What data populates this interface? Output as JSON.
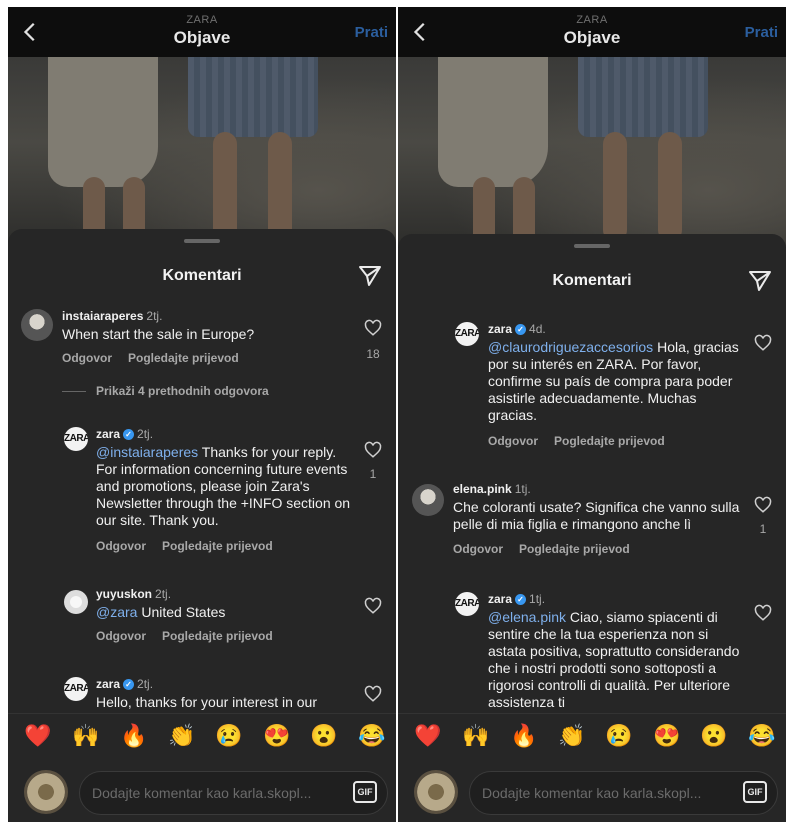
{
  "header": {
    "brand": "ZARA",
    "title": "Objave",
    "follow_label": "Prati"
  },
  "sheet": {
    "title": "Komentari"
  },
  "left": {
    "c1": {
      "user": "instaiaraperes",
      "time": "2tj.",
      "text": "When start the sale in Europe?",
      "reply": "Odgovor",
      "translate": "Pogledajte prijevod",
      "likes": "18"
    },
    "more_replies": "Prikaži 4 prethodnih odgovora",
    "c2": {
      "user": "zara",
      "time": "2tj.",
      "mention": "@instaiaraperes",
      "text": " Thanks for your reply. For information concerning future events and promotions, please join Zara's Newsletter through the +INFO section on our site. Thank you.",
      "reply": "Odgovor",
      "translate": "Pogledajte prijevod",
      "likes": "1"
    },
    "c3": {
      "user": "yuyuskon",
      "time": "2tj.",
      "mention": "@zara",
      "text": " United States",
      "reply": "Odgovor",
      "translate": "Pogledajte prijevod"
    },
    "c4": {
      "user": "zara",
      "time": "2tj.",
      "text": "Hello, thanks for your interest in our"
    }
  },
  "right": {
    "c1": {
      "user": "zara",
      "time": "4d.",
      "mention": "@claurodriguezaccesorios",
      "text": " Hola, gracias por su interés en ZARA. Por favor, confirme su país de compra para poder asistirle adecuadamente. Muchas gracias.",
      "reply": "Odgovor",
      "translate": "Pogledajte prijevod"
    },
    "c2": {
      "user": "elena.pink",
      "time": "1tj.",
      "text": "Che coloranti usate? Significa che vanno sulla pelle di mia figlia e rimangono anche lì",
      "reply": "Odgovor",
      "translate": "Pogledajte prijevod",
      "likes": "1"
    },
    "c3": {
      "user": "zara",
      "time": "1tj.",
      "mention": "@elena.pink",
      "text": " Ciao, siamo spiacenti di sentire che la tua esperienza non si astata positiva, soprattutto considerando che i nostri prodotti sono sottoposti a rigorosi controlli di qualità. Per ulteriore assistenza ti"
    }
  },
  "emojis": [
    "❤️",
    "🙌",
    "🔥",
    "👏",
    "😢",
    "😍",
    "😮",
    "😂"
  ],
  "input": {
    "placeholder": "Dodajte komentar kao karla.skopl...",
    "gif_label": "GIF"
  },
  "zara_avatar_text": "ZARA"
}
